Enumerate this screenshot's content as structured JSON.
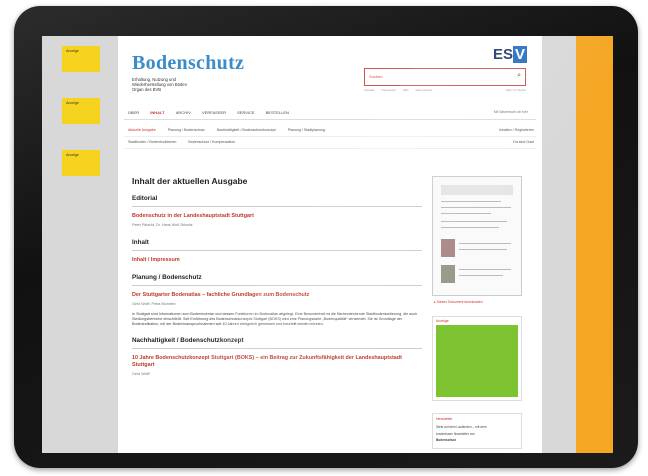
{
  "ads": {
    "label": "Anzeige"
  },
  "header": {
    "title": "Bodenschutz",
    "subtitle_lines": [
      "Erhaltung, Nutzung und",
      "Wiederherstellung von Böden",
      "Organ des BVB"
    ],
    "logo": {
      "es": "ES",
      "y": "V"
    },
    "search_placeholder": "Suchen",
    "search_icon": "⌕",
    "utility_links": [
      "Kontakt",
      "Impressum",
      "Hilfe",
      "Datenschutz"
    ],
    "utility_right": "Hilfe zur Suche"
  },
  "nav": {
    "items": [
      "ÜBER",
      "INHALT",
      "ARCHIV",
      "VERFASSER",
      "SERVICE",
      "BESTELLEN"
    ],
    "active_index": 1,
    "right": "Mit Warenkorb ab hier"
  },
  "subnav": {
    "row1": [
      "Aktuelle Ausgabe",
      "Planung / Bodenschutz",
      "Nachhaltigkeit / Bodenschutzkonzept",
      "Planung / Stadtplanung"
    ],
    "row1_right": "Inhalten / Registrieren",
    "row2": [
      "Stadtboden / Bodenfunktionen",
      "Bodenschutz / Kompensation"
    ],
    "row2_right": "Da sind Gast"
  },
  "main": {
    "heading": "Inhalt der aktuellen Ausgabe",
    "sections": [
      {
        "title": "Editorial",
        "link": "Bodenschutz in der Landeshauptstadt Stuttgart",
        "authors": "Peter Pätzold, Dr. Hans-Wolf Zirkwitz",
        "text": ""
      },
      {
        "title": "Inhalt",
        "link": "Inhalt / Impressum",
        "authors": "",
        "text": ""
      },
      {
        "title": "Planung / Bodenschutz",
        "link": "Der Stuttgarter Bodenatlas – fachliche Grundlagen zum Bodenschutz",
        "authors": "Gerd Wolff, Petra Blumlein",
        "text": "In Stuttgart sind Informationen zum Bodeninventar und dessen Funktionen im Bodenatlas abgelegt. Eine Besonderheit ist die flächendeckende Stadtbodenkartierung, die auch Siedlungsbereiche einschließt. Seit Einführung des Bodenschutzkonzepts Stuttgart (BOKS) wird eine Planungskarte „Bodenqualität“ verwendet. Sie ist Grundlage der Bodenindikation, mit der Bodeninanspruchnahmen seit 10 Jahren erfolgreich gemessen und beurteilt werden können."
      },
      {
        "title": "Nachhaltigkeit / Bodenschutzkonzept",
        "link": "10 Jahre Bodenschutzkonzept Stuttgart (BOKS) – ein Beitrag zur Zukunftsfähigkeit der Landeshauptstadt Stuttgart",
        "authors": "Gerd Wolff",
        "text": ""
      }
    ]
  },
  "sidebar": {
    "download": "▸ Dieses Dokument downloaden",
    "ad_label": "Anzeige",
    "newsletter": {
      "title": "Newsletter",
      "text_lines": [
        "Stets auf dem Laufenden – mit dem",
        "kostenlosen Newsletter von"
      ],
      "bold": "Bodenschutz"
    }
  },
  "colors": {
    "accent_red": "#c0392b",
    "title_blue": "#3a8dc9",
    "ad_yellow": "#f5d31e",
    "ad_orange": "#f5a623",
    "ad_green": "#7ec332"
  }
}
